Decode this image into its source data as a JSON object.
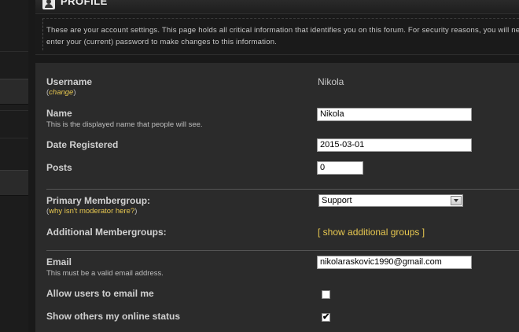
{
  "header": {
    "title": "PROFILE"
  },
  "info": {
    "text": "These are your account settings. This page holds all critical information that identifies you on this forum. For security reasons, you will need to enter your (current) password to make changes to this information."
  },
  "fields": {
    "username": {
      "label": "Username",
      "change_link": "change",
      "value": "Nikola"
    },
    "name": {
      "label": "Name",
      "description": "This is the displayed name that people will see.",
      "value": "Nikola"
    },
    "date_registered": {
      "label": "Date Registered",
      "value": "2015-03-01"
    },
    "posts": {
      "label": "Posts",
      "value": "0"
    },
    "primary_group": {
      "label": "Primary Membergroup:",
      "help_link": "why isn't moderator here?",
      "selected": "Support"
    },
    "additional_groups": {
      "label": "Additional Membergroups:",
      "link": "[ show additional groups ]"
    },
    "email": {
      "label": "Email",
      "description": "This must be a valid email address.",
      "value": "nikolaraskovic1990@gmail.com"
    },
    "allow_email": {
      "label": "Allow users to email me",
      "checked": false
    },
    "show_online": {
      "label": "Show others my online status",
      "checked": true,
      "mark": "✔"
    }
  },
  "icons": {
    "profile": "profile-user-icon",
    "dropdown": "chevron-down-icon"
  }
}
